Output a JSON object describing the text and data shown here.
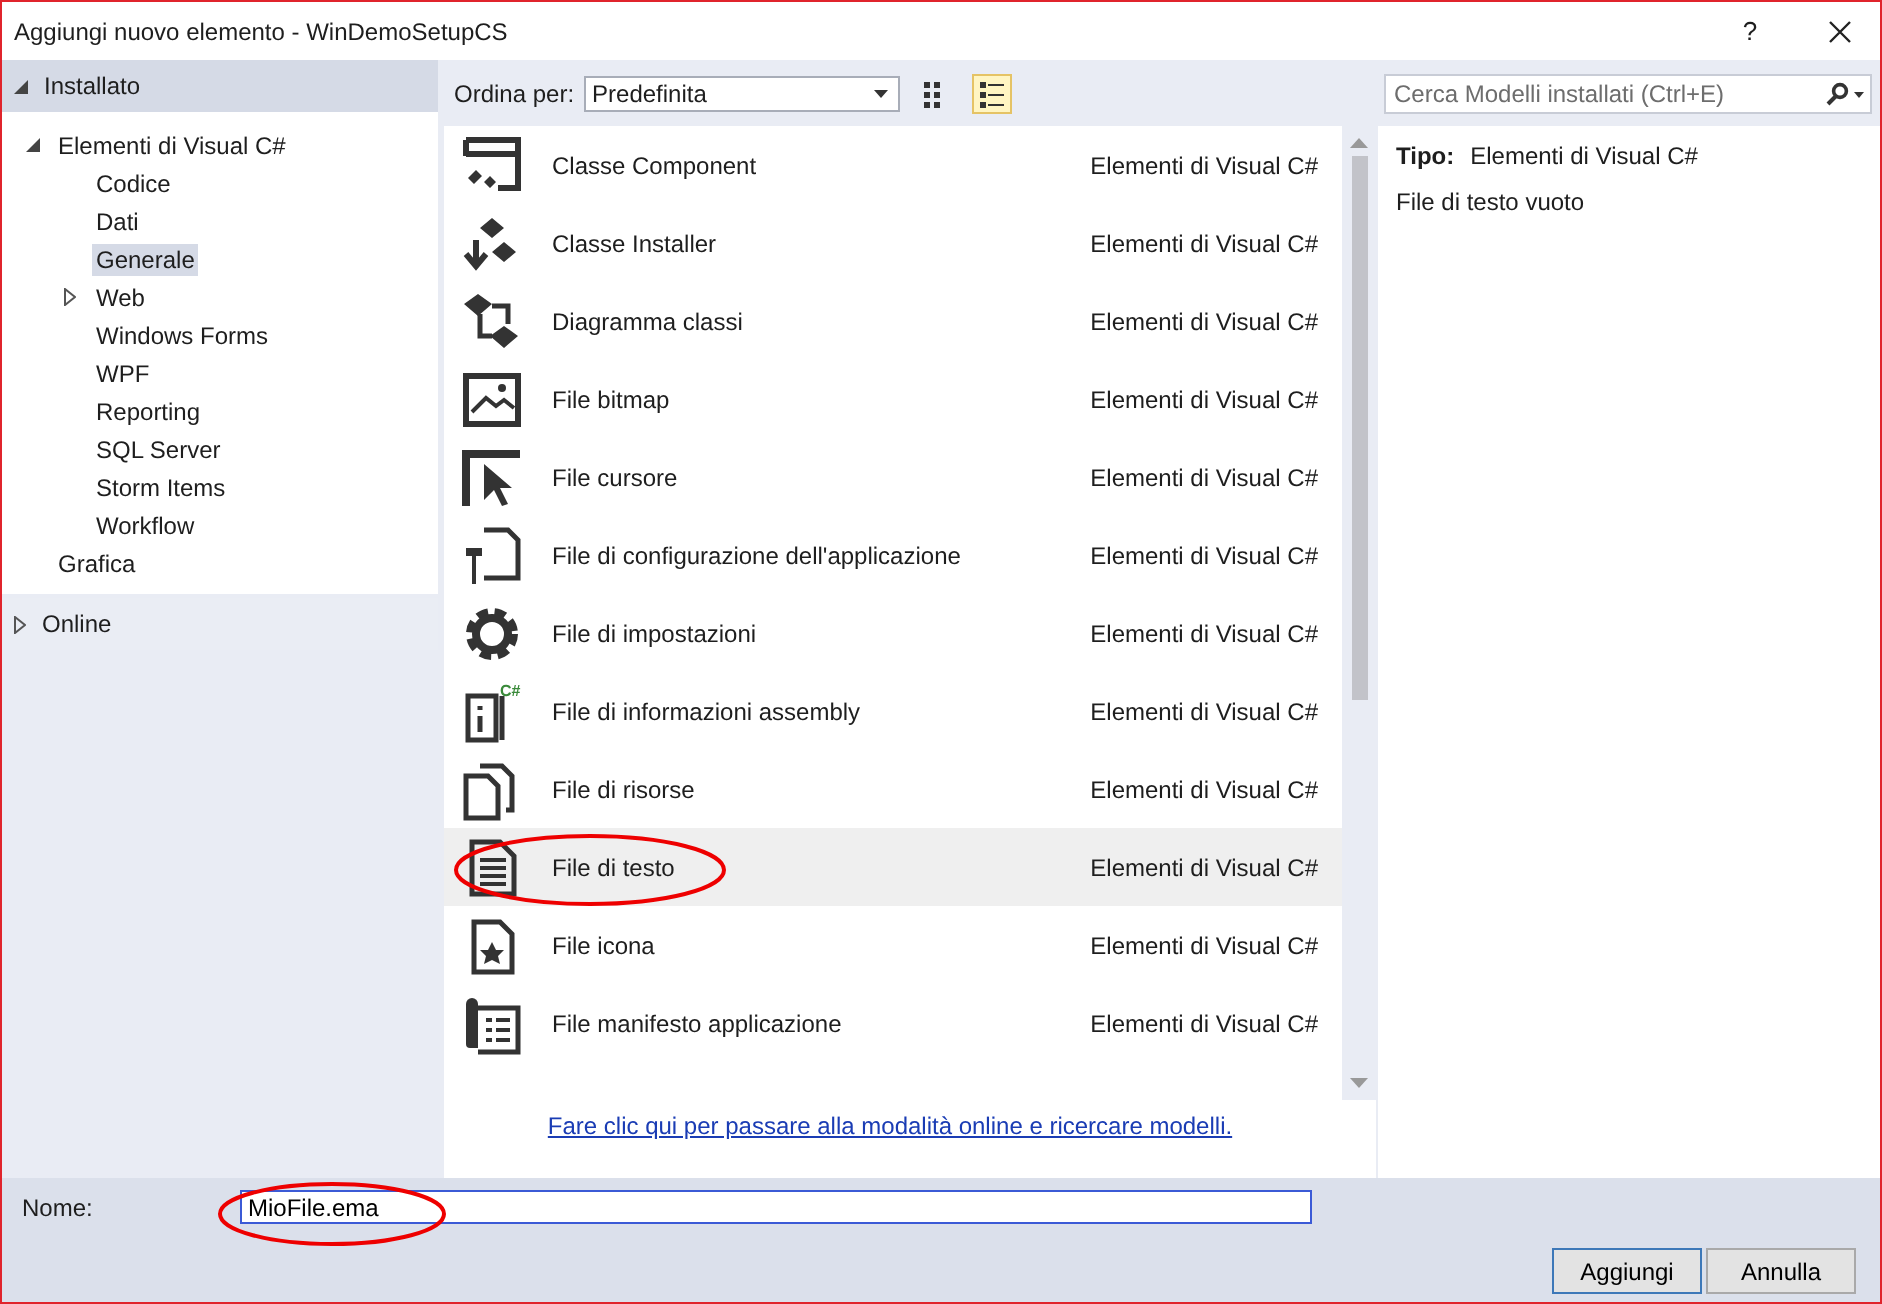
{
  "window": {
    "title": "Aggiungi nuovo elemento - WinDemoSetupCS",
    "help": "?"
  },
  "sidebar": {
    "tree": [
      {
        "label": "Installato",
        "expanded": true,
        "children": [
          {
            "label": "Elementi di Visual C#",
            "expanded": true,
            "selected": false,
            "children": [
              {
                "label": "Codice",
                "selected": false
              },
              {
                "label": "Dati",
                "selected": false
              },
              {
                "label": "Generale",
                "selected": true
              },
              {
                "label": "Web",
                "selected": false,
                "expanded": false
              },
              {
                "label": "Windows Forms",
                "selected": false
              },
              {
                "label": "WPF",
                "selected": false
              },
              {
                "label": "Reporting",
                "selected": false
              },
              {
                "label": "SQL Server",
                "selected": false
              },
              {
                "label": "Storm Items",
                "selected": false
              },
              {
                "label": "Workflow",
                "selected": false
              }
            ]
          },
          {
            "label": "Grafica",
            "selected": false
          }
        ]
      },
      {
        "label": "Online",
        "expanded": false
      }
    ]
  },
  "toolbar": {
    "sort_label": "Ordina per:",
    "sort_value": "Predefinita",
    "views": [
      {
        "kind": "grid",
        "selected": false
      },
      {
        "kind": "list",
        "selected": true
      }
    ],
    "search": {
      "placeholder": "Cerca Modelli installati (Ctrl+E)"
    }
  },
  "templates": [
    {
      "kind": "component",
      "name": "Classe Component",
      "category": "Elementi di Visual C#",
      "selected": false
    },
    {
      "kind": "installer",
      "name": "Classe Installer",
      "category": "Elementi di Visual C#",
      "selected": false
    },
    {
      "kind": "diagram",
      "name": "Diagramma classi",
      "category": "Elementi di Visual C#",
      "selected": false
    },
    {
      "kind": "bitmap",
      "name": "File bitmap",
      "category": "Elementi di Visual C#",
      "selected": false
    },
    {
      "kind": "cursor",
      "name": "File cursore",
      "category": "Elementi di Visual C#",
      "selected": false
    },
    {
      "kind": "config",
      "name": "File di configurazione dell'applicazione",
      "category": "Elementi di Visual C#",
      "selected": false
    },
    {
      "kind": "settings",
      "name": "File di impostazioni",
      "category": "Elementi di Visual C#",
      "selected": false
    },
    {
      "kind": "assembly",
      "badge": "C#",
      "name": "File di informazioni assembly",
      "category": "Elementi di Visual C#",
      "selected": false
    },
    {
      "kind": "resource",
      "name": "File di risorse",
      "category": "Elementi di Visual C#",
      "selected": false
    },
    {
      "kind": "text",
      "name": "File di testo",
      "category": "Elementi di Visual C#",
      "selected": true
    },
    {
      "kind": "icon",
      "name": "File icona",
      "category": "Elementi di Visual C#",
      "selected": false
    },
    {
      "kind": "manifest",
      "name": "File manifesto applicazione",
      "category": "Elementi di Visual C#",
      "selected": false
    }
  ],
  "online_link": "Fare clic qui per passare alla modalità online e ricercare modelli.",
  "details": {
    "type_label": "Tipo:",
    "type_value": "Elementi di Visual C#",
    "description": "File di testo vuoto"
  },
  "footer": {
    "name_label": "Nome:",
    "name_value": "MioFile.ema",
    "buttons": [
      {
        "label": "Aggiungi",
        "default": true
      },
      {
        "label": "Annulla",
        "default": false
      }
    ]
  }
}
